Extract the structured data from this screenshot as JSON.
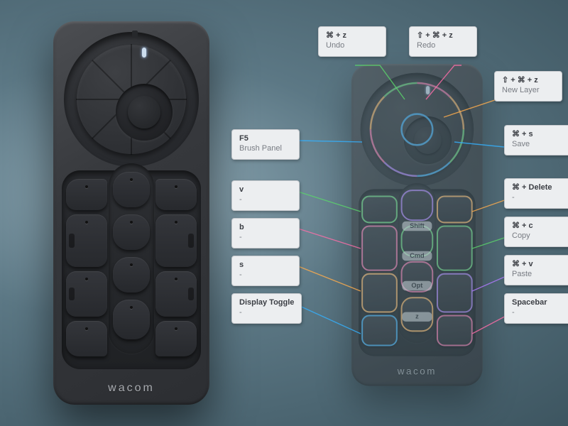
{
  "brand": "wacom",
  "callouts": {
    "undo": {
      "keys": "⌘ + z",
      "label": "Undo"
    },
    "redo": {
      "keys": "⇧ + ⌘ + z",
      "label": "Redo"
    },
    "new_layer": {
      "keys": "⇧ + ⌘ + z",
      "label": "New Layer"
    },
    "save": {
      "keys": "⌘ + s",
      "label": "Save"
    },
    "delete": {
      "keys": "⌘ + Delete",
      "label": "-"
    },
    "copy": {
      "keys": "⌘ + c",
      "label": "Copy"
    },
    "paste": {
      "keys": "⌘ + v",
      "label": "Paste"
    },
    "spacebar": {
      "keys": "Spacebar",
      "label": "-"
    },
    "brush_panel": {
      "keys": "F5",
      "label": "Brush Panel"
    },
    "v": {
      "keys": "v",
      "label": "-"
    },
    "b": {
      "keys": "b",
      "label": "-"
    },
    "s": {
      "keys": "s",
      "label": "-"
    },
    "display_toggle": {
      "keys": "Display Toggle",
      "label": "-"
    }
  },
  "center_buttons": {
    "b1": "Shift",
    "b2": "Cmd",
    "b3": "Opt",
    "b4": "z"
  }
}
